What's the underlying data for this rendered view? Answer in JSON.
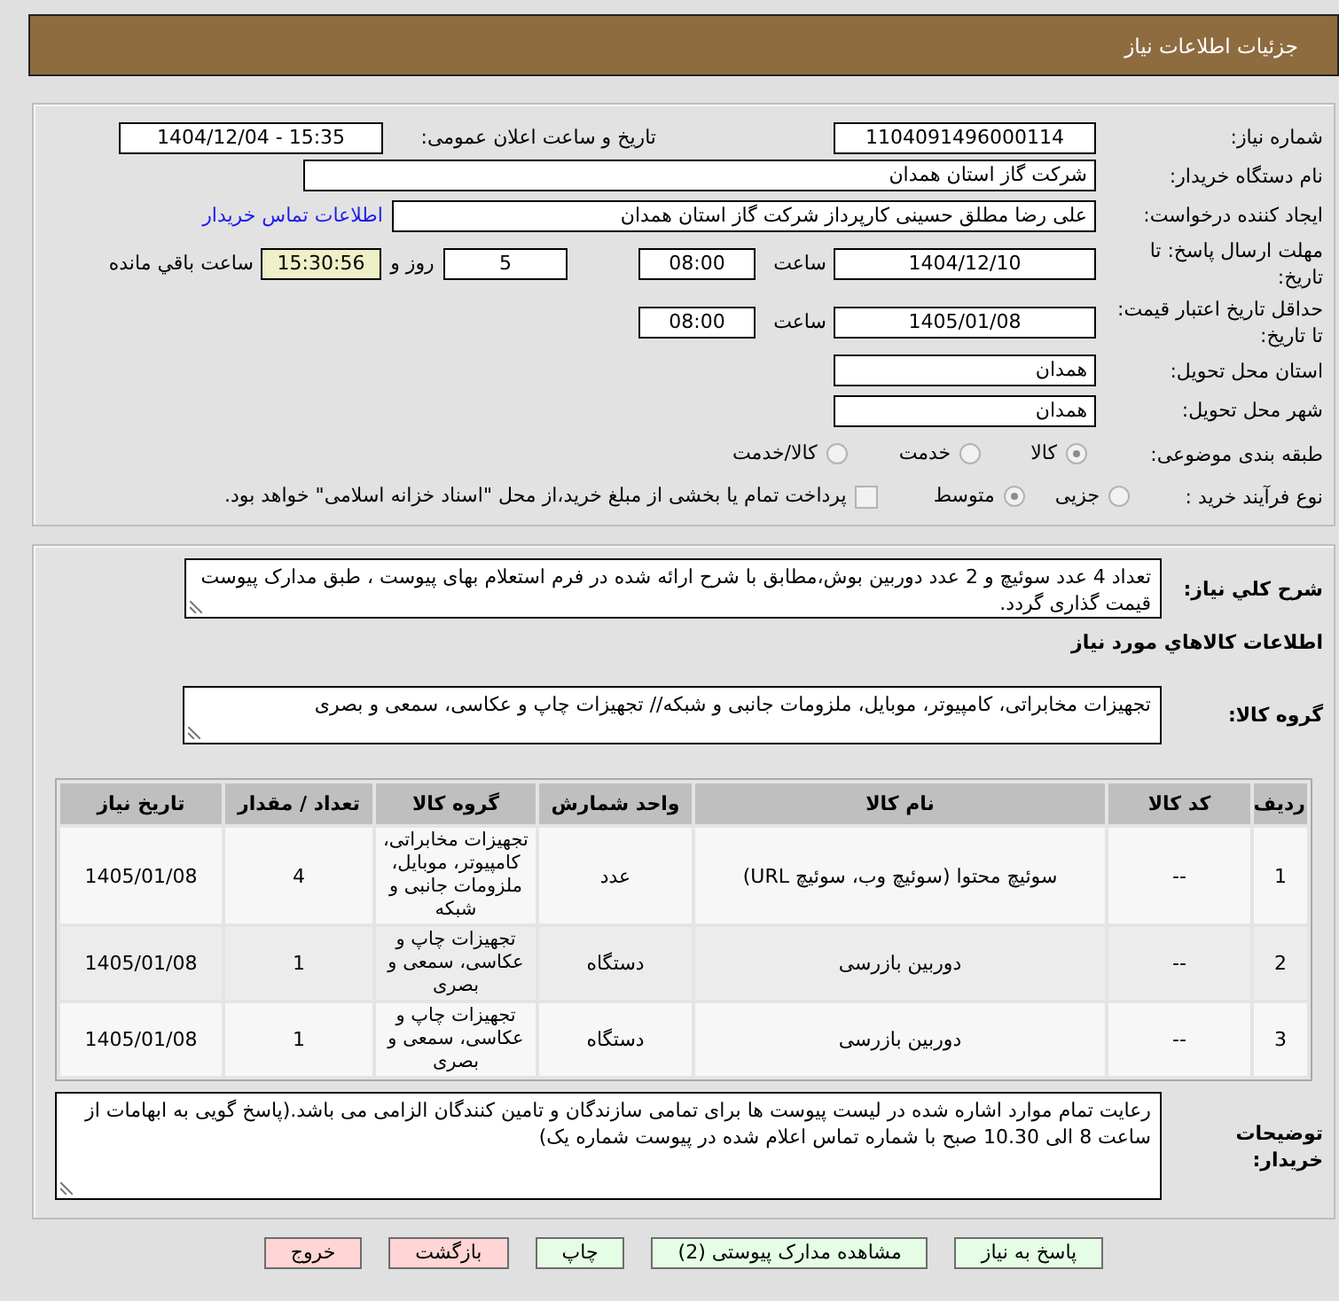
{
  "page_title": "جزئیات اطلاعات نیاز",
  "details": {
    "need_number": {
      "label": "شماره نیاز:",
      "value": "1104091496000114"
    },
    "announce_datetime": {
      "label": "تاریخ و ساعت اعلان عمومی:",
      "value": "1404/12/04 - 15:35"
    },
    "buyer_org": {
      "label": "نام دستگاه خریدار:",
      "value": "شرکت گاز استان همدان"
    },
    "requester": {
      "label": "ایجاد کننده درخواست:",
      "value": "علی رضا مطلق حسینی کارپرداز شرکت گاز استان همدان",
      "link": "اطلاعات تماس خریدار"
    },
    "reply_deadline": {
      "label": "مهلت ارسال پاسخ: تا تاریخ:",
      "date": "1404/12/10",
      "time_label": "ساعت",
      "time": "08:00",
      "days": "5",
      "days_label": "روز و",
      "remaining": "15:30:56",
      "remaining_label": "ساعت باقي مانده"
    },
    "price_validity": {
      "label": "حداقل تاریخ اعتبار قیمت: تا تاریخ:",
      "date": "1405/01/08",
      "time_label": "ساعت",
      "time": "08:00"
    },
    "delivery_province": {
      "label": "استان محل تحویل:",
      "value": "همدان"
    },
    "delivery_city": {
      "label": "شهر محل تحویل:",
      "value": "همدان"
    },
    "subject_category": {
      "label": "طبقه بندی موضوعی:",
      "disabled": true,
      "options": [
        {
          "label": "کالا",
          "selected": true
        },
        {
          "label": "خدمت",
          "selected": false
        },
        {
          "label": "کالا/خدمت",
          "selected": false
        }
      ]
    },
    "purchase_process": {
      "label": "نوع فرآیند خرید :",
      "disabled": true,
      "options": [
        {
          "label": "جزیی",
          "selected": false
        },
        {
          "label": "متوسط",
          "selected": true
        }
      ],
      "treasury_checkbox": {
        "label": "پرداخت تمام یا بخشی از مبلغ خرید،از محل \"اسناد خزانه اسلامی\" خواهد بود.",
        "checked": false
      }
    }
  },
  "requirements": {
    "description": {
      "label": "شرح کلي نیاز:",
      "value": "تعداد 4 عدد سوئیچ و 2 عدد دوربین بوش،مطابق با شرح ارائه شده در فرم استعلام بهای پیوست ، طبق مدارک پیوست قیمت گذاری گردد."
    },
    "items_heading": "اطلاعات کالاهاي مورد نیاز",
    "goods_group": {
      "label": "گروه کالا:",
      "value": "تجهیزات مخابراتی، کامپیوتر، موبایل، ملزومات جانبی و شبکه// تجهیزات چاپ و عکاسی، سمعی و بصری"
    },
    "table": {
      "columns": [
        "ردیف",
        "کد کالا",
        "نام کالا",
        "واحد شمارش",
        "گروه کالا",
        "تعداد / مقدار",
        "تاریخ نیاز"
      ],
      "rows": [
        [
          "1",
          "--",
          "سوئیچ محتوا (سوئیچ وب، سوئیچ URL)",
          "عدد",
          "تجهیزات مخابراتی، کامپیوتر، موبایل، ملزومات جانبی و شبکه",
          "4",
          "1405/01/08"
        ],
        [
          "2",
          "--",
          "دوربین بازرسی",
          "دستگاه",
          "تجهیزات چاپ و عکاسی، سمعی و بصری",
          "1",
          "1405/01/08"
        ],
        [
          "3",
          "--",
          "دوربین بازرسی",
          "دستگاه",
          "تجهیزات چاپ و عکاسی، سمعی و بصری",
          "1",
          "1405/01/08"
        ]
      ]
    },
    "buyer_notes": {
      "label": "توضیحات خریدار:",
      "value": "رعایت تمام موارد اشاره شده در لیست پیوست ها برای تمامی سازندگان و تامین کنندگان الزامی می باشد.(پاسخ گویی به ابهامات از ساعت 8 الی 10.30 صبح با شماره تماس اعلام شده در پیوست شماره یک)"
    }
  },
  "buttons": [
    {
      "label": "پاسخ به نیاز",
      "kind": "action"
    },
    {
      "label": "مشاهده مدارک پیوستی (2)",
      "kind": "action"
    },
    {
      "label": "چاپ",
      "kind": "action"
    },
    {
      "label": "بازگشت",
      "kind": "exit"
    },
    {
      "label": "خروج",
      "kind": "exit"
    }
  ]
}
